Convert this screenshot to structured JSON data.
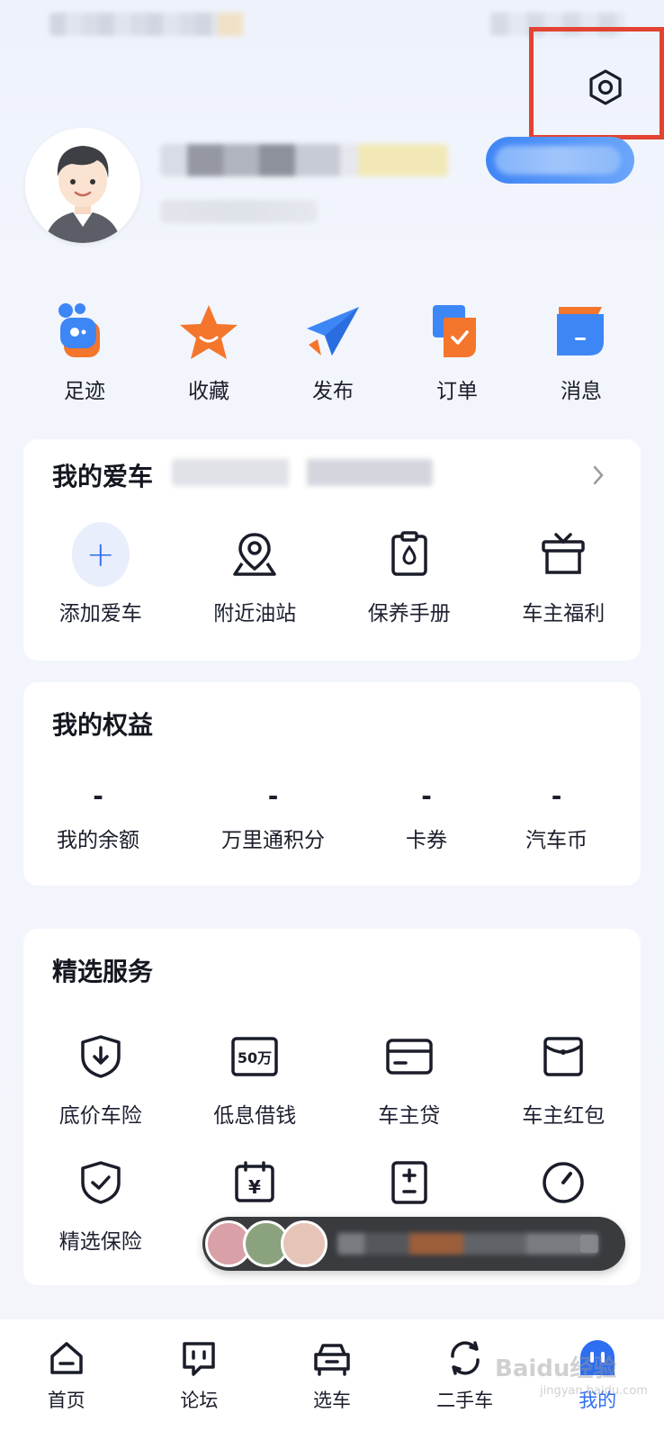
{
  "quick_actions": [
    {
      "label": "足迹",
      "icon": "footprint-icon"
    },
    {
      "label": "收藏",
      "icon": "star-icon"
    },
    {
      "label": "发布",
      "icon": "paper-plane-icon"
    },
    {
      "label": "订单",
      "icon": "order-icon"
    },
    {
      "label": "消息",
      "icon": "message-icon"
    }
  ],
  "my_car": {
    "title": "我的爱车",
    "items": [
      {
        "label": "添加爱车",
        "icon": "plus-icon"
      },
      {
        "label": "附近油站",
        "icon": "location-pin-icon"
      },
      {
        "label": "保养手册",
        "icon": "oil-manual-icon"
      },
      {
        "label": "车主福利",
        "icon": "gift-icon"
      }
    ]
  },
  "equity": {
    "title": "我的权益",
    "items": [
      {
        "value": "-",
        "label": "我的余额"
      },
      {
        "value": "-",
        "label": "万里通积分"
      },
      {
        "value": "-",
        "label": "卡券"
      },
      {
        "value": "-",
        "label": "汽车币"
      }
    ]
  },
  "services": {
    "title": "精选服务",
    "row1": [
      {
        "label": "底价车险",
        "icon": "shield-download-icon"
      },
      {
        "label": "低息借钱",
        "icon": "50wan-icon",
        "badge": "50万"
      },
      {
        "label": "车主贷",
        "icon": "card-icon"
      },
      {
        "label": "车主红包",
        "icon": "red-packet-icon"
      }
    ],
    "row2": [
      {
        "label": "精选保险",
        "icon": "shield-check-icon"
      },
      {
        "label": "",
        "icon": "calendar-yen-icon",
        "badge": "¥"
      },
      {
        "label": "",
        "icon": "calculator-icon"
      },
      {
        "label": "",
        "icon": "gauge-icon"
      }
    ]
  },
  "bottom_nav": [
    {
      "label": "首页",
      "icon": "home-icon"
    },
    {
      "label": "论坛",
      "icon": "forum-icon"
    },
    {
      "label": "选车",
      "icon": "car-icon"
    },
    {
      "label": "二手车",
      "icon": "refresh-icon"
    },
    {
      "label": "我的",
      "icon": "profile-icon",
      "active": true
    }
  ],
  "watermark": {
    "text": "Baidu经验",
    "sub": "jingyan.baidu.com"
  },
  "colors": {
    "accent": "#2e6ef0",
    "highlight": "#e24332",
    "orange": "#f4752c"
  }
}
